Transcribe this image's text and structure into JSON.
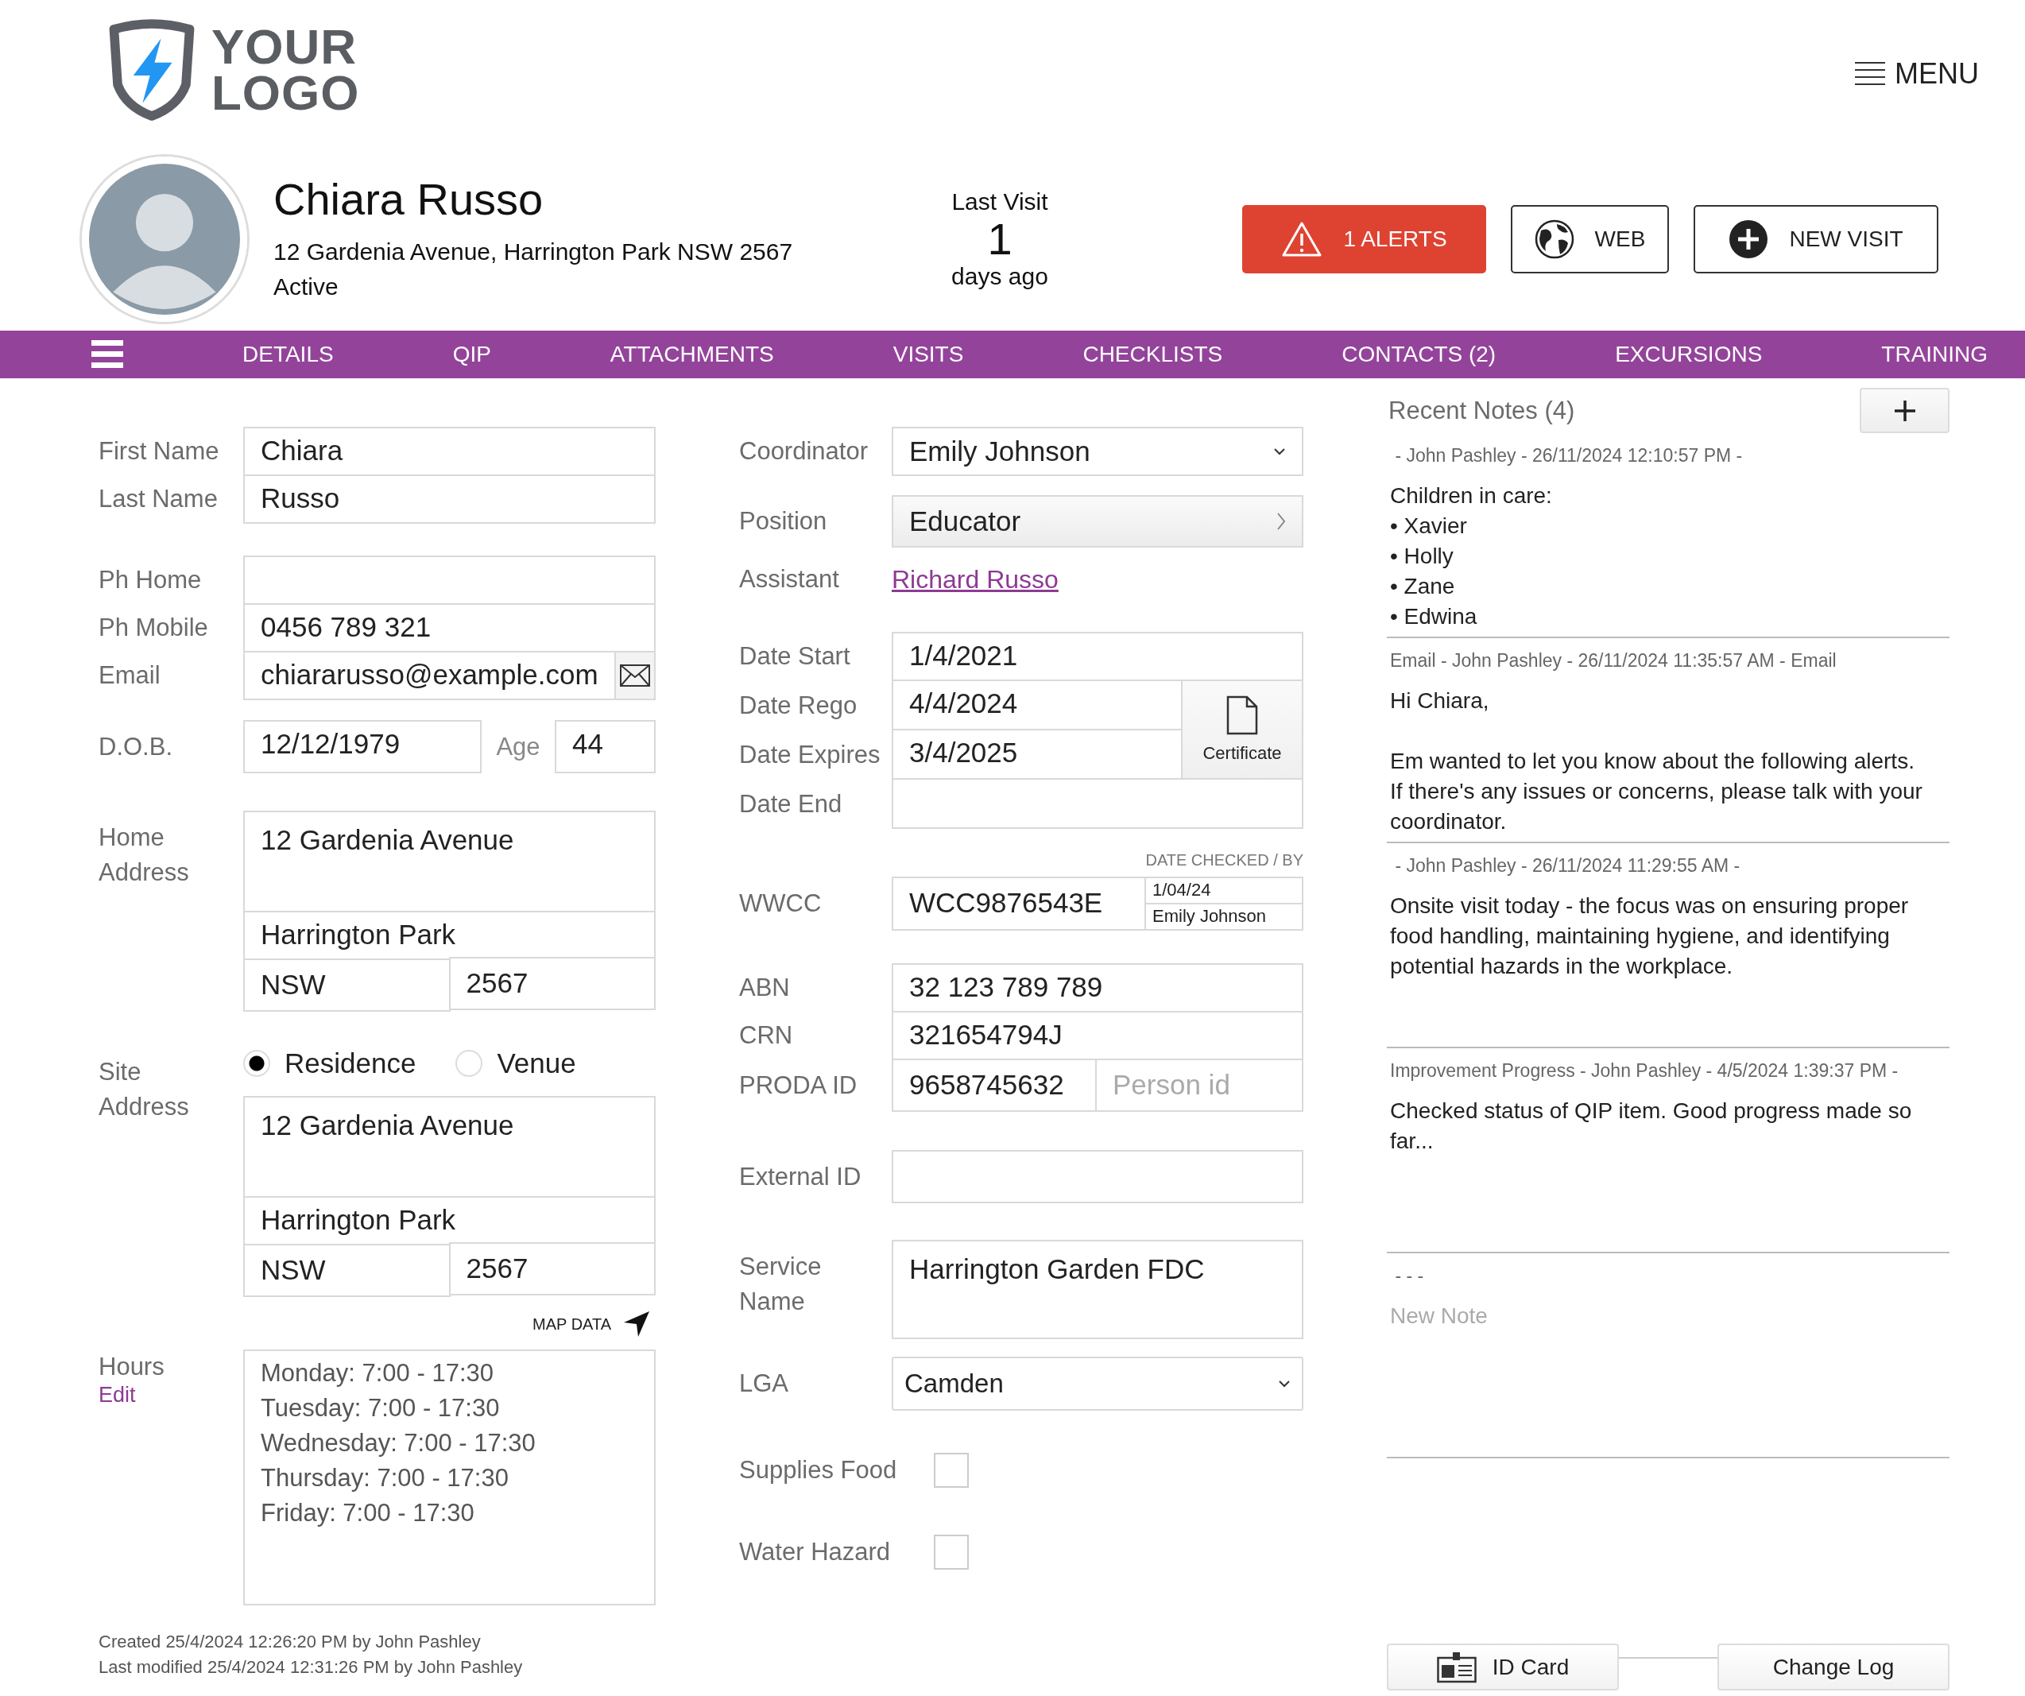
{
  "logo": {
    "line1": "YOUR",
    "line2": "LOGO"
  },
  "menu": {
    "label": "MENU"
  },
  "profile": {
    "name": "Chiara Russo",
    "address": "12 Gardenia Avenue, Harrington Park NSW 2567",
    "status": "Active"
  },
  "last_visit": {
    "label": "Last Visit",
    "value": "1",
    "unit": "days ago"
  },
  "actions": [
    {
      "kind": "alert",
      "label": "1 ALERTS"
    },
    {
      "kind": "web",
      "label": "WEB"
    },
    {
      "kind": "new",
      "label": "NEW VISIT"
    }
  ],
  "nav": {
    "tabs": [
      {
        "label": "DETAILS"
      },
      {
        "label": "QIP"
      },
      {
        "label": "ATTACHMENTS"
      },
      {
        "label": "VISITS"
      },
      {
        "label": "CHECKLISTS"
      },
      {
        "label": "CONTACTS (2)"
      },
      {
        "label": "EXCURSIONS"
      },
      {
        "label": "TRAINING"
      }
    ]
  },
  "left": {
    "names": [
      {
        "label": "First Name",
        "value": "Chiara"
      },
      {
        "label": "Last Name",
        "value": "Russo"
      }
    ],
    "phones": [
      {
        "label": "Ph Home"
      },
      {
        "label": "Ph Mobile",
        "value": "0456 789 321"
      },
      {
        "label": "Email",
        "value": "chiararusso@example.com",
        "kind": "email"
      }
    ],
    "dob": {
      "label": "D.O.B.",
      "value": "12/12/1979",
      "age_label": "Age",
      "age": "44"
    },
    "home_address": {
      "label": "Home Address",
      "street": "12 Gardenia Avenue",
      "suburb": "Harrington Park",
      "state": "NSW",
      "postcode": "2567"
    },
    "site_address": {
      "label": "Site Address",
      "options": [
        {
          "label": "Residence",
          "selected": true
        },
        {
          "label": "Venue",
          "selected": false
        }
      ],
      "street": "12 Gardenia Avenue",
      "suburb": "Harrington Park",
      "state": "NSW",
      "postcode": "2567"
    },
    "map_data": "MAP DATA",
    "hours": {
      "label": "Hours",
      "edit": "Edit",
      "lines": [
        "Monday: 7:00 - 17:30",
        "Tuesday: 7:00 - 17:30",
        "Wednesday: 7:00 - 17:30",
        "Thursday: 7:00 - 17:30",
        "Friday: 7:00 - 17:30"
      ]
    },
    "created": "Created 25/4/2024 12:26:20 PM by John Pashley",
    "modified": "Last modified 25/4/2024 12:31:26 PM by John Pashley"
  },
  "middle": {
    "coordinator": {
      "label": "Coordinator",
      "value": "Emily Johnson"
    },
    "position": {
      "label": "Position",
      "value": "Educator"
    },
    "assistant": {
      "label": "Assistant",
      "value": "Richard Russo"
    },
    "dates": [
      {
        "label": "Date Start",
        "value": "1/4/2021"
      },
      {
        "label": "Date Rego",
        "value": "4/4/2024"
      },
      {
        "label": "Date Expires",
        "value": "3/4/2025"
      },
      {
        "label": "Date End"
      }
    ],
    "certificate": "Certificate",
    "wwcc": {
      "header": "DATE CHECKED / BY",
      "label": "WWCC",
      "value": "WCC9876543E",
      "date_checked": "1/04/24",
      "checked_by": "Emily Johnson"
    },
    "ids": [
      {
        "label": "ABN",
        "value": "32 123 789 789"
      },
      {
        "label": "CRN",
        "value": "321654794J"
      },
      {
        "label": "PRODA ID",
        "value": "9658745632",
        "placeholder": "Person id"
      }
    ],
    "external_id": {
      "label": "External ID"
    },
    "service_name": {
      "label": "Service Name",
      "value": "Harrington Garden FDC"
    },
    "lga": {
      "label": "LGA",
      "value": "Camden"
    },
    "flags": [
      {
        "label": "Supplies Food",
        "checked": false
      },
      {
        "label": "Water Hazard",
        "checked": false
      }
    ]
  },
  "notes": {
    "title": "Recent Notes (4)",
    "items": [
      {
        "header": " - John Pashley - 26/11/2024 12:10:57 PM -",
        "body": "Children in care:\n• Xavier\n• Holly\n• Zane\n• Edwina"
      },
      {
        "header": "Email - John Pashley - 26/11/2024 11:35:57 AM - Email",
        "body": "Hi Chiara,\n\nEm wanted to let you know about the following alerts.\nIf there's any issues or concerns, please talk with your coordinator."
      },
      {
        "header": " - John Pashley - 26/11/2024 11:29:55 AM -",
        "body": "Onsite visit today - the focus was on ensuring proper food handling, maintaining hygiene, and identifying potential hazards in the workplace."
      },
      {
        "header": "Improvement Progress - John Pashley - 4/5/2024 1:39:37 PM -",
        "body": "Checked status of QIP item. Good progress made so far..."
      }
    ],
    "new_note": {
      "header": " - - -",
      "placeholder": "New Note"
    }
  },
  "footer_buttons": [
    {
      "kind": "id_card",
      "label": "ID Card"
    },
    {
      "kind": "plain",
      "label": "Change Log"
    }
  ]
}
